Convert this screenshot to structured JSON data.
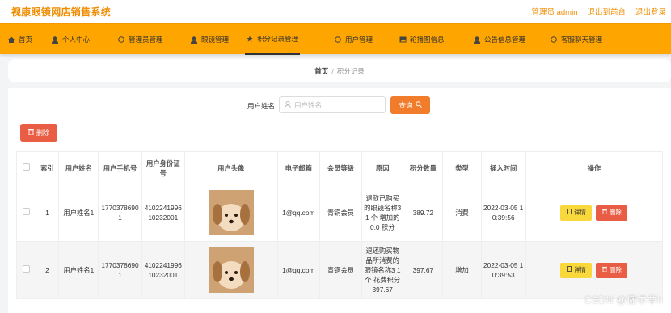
{
  "header": {
    "brand": "视康眼镜网店销售系统",
    "admin_label": "管理员 admin",
    "back_to_front": "退出到前台",
    "logout": "退出登录"
  },
  "nav": {
    "items": [
      {
        "label": "首页",
        "icon": "home-icon"
      },
      {
        "label": "个人中心",
        "icon": "user-icon"
      },
      {
        "label": "管理员管理",
        "icon": "admin-icon"
      },
      {
        "label": "眼镜管理",
        "icon": "user-icon"
      },
      {
        "label": "积分记录管理",
        "icon": "star-icon"
      },
      {
        "label": "用户管理",
        "icon": "users-icon"
      },
      {
        "label": "轮播图信息",
        "icon": "image-icon"
      },
      {
        "label": "公告信息管理",
        "icon": "user-icon"
      },
      {
        "label": "客服聊天管理",
        "icon": "chat-icon"
      }
    ],
    "active_index": 4
  },
  "breadcrumb": {
    "home": "首页",
    "separator": "/",
    "current": "积分记录"
  },
  "search": {
    "label": "用户姓名",
    "placeholder": "用户姓名",
    "value": "",
    "query_label": "查询"
  },
  "actions": {
    "delete_label": "删除"
  },
  "table": {
    "headers": [
      "索引",
      "用户姓名",
      "用户手机号",
      "用户身份证号",
      "用户头像",
      "电子邮箱",
      "会员等级",
      "原因",
      "积分数量",
      "类型",
      "插入时间",
      "操作"
    ],
    "rows": [
      {
        "index": "1",
        "name": "用户姓名1",
        "phone": "17703786901",
        "id_card": "410224199610232001",
        "email": "1@qq.com",
        "level": "青铜会员",
        "reason": "退款已购买的眼镜名称3 1 个 增加的 0.0 积分",
        "points": "389.72",
        "type": "消费",
        "time": "2022-03-05 10:39:56",
        "detail_label": "详情",
        "delete_label": "删除"
      },
      {
        "index": "2",
        "name": "用户姓名1",
        "phone": "17703786901",
        "id_card": "410224199610232001",
        "email": "1@qq.com",
        "level": "青铜会员",
        "reason": "退还购买物品所消费的眼镜名称3 1 个 花费积分 397.67",
        "points": "397.67",
        "type": "增加",
        "time": "2022-03-05 10:39:53",
        "detail_label": "详情",
        "delete_label": "删除"
      }
    ]
  },
  "watermark": "CSDN @懒羊羊h",
  "colors": {
    "accent": "#ffa500",
    "brand_text": "#f08c00",
    "query": "#f07c2c",
    "danger": "#e95d45",
    "detail": "#f8d83a"
  }
}
